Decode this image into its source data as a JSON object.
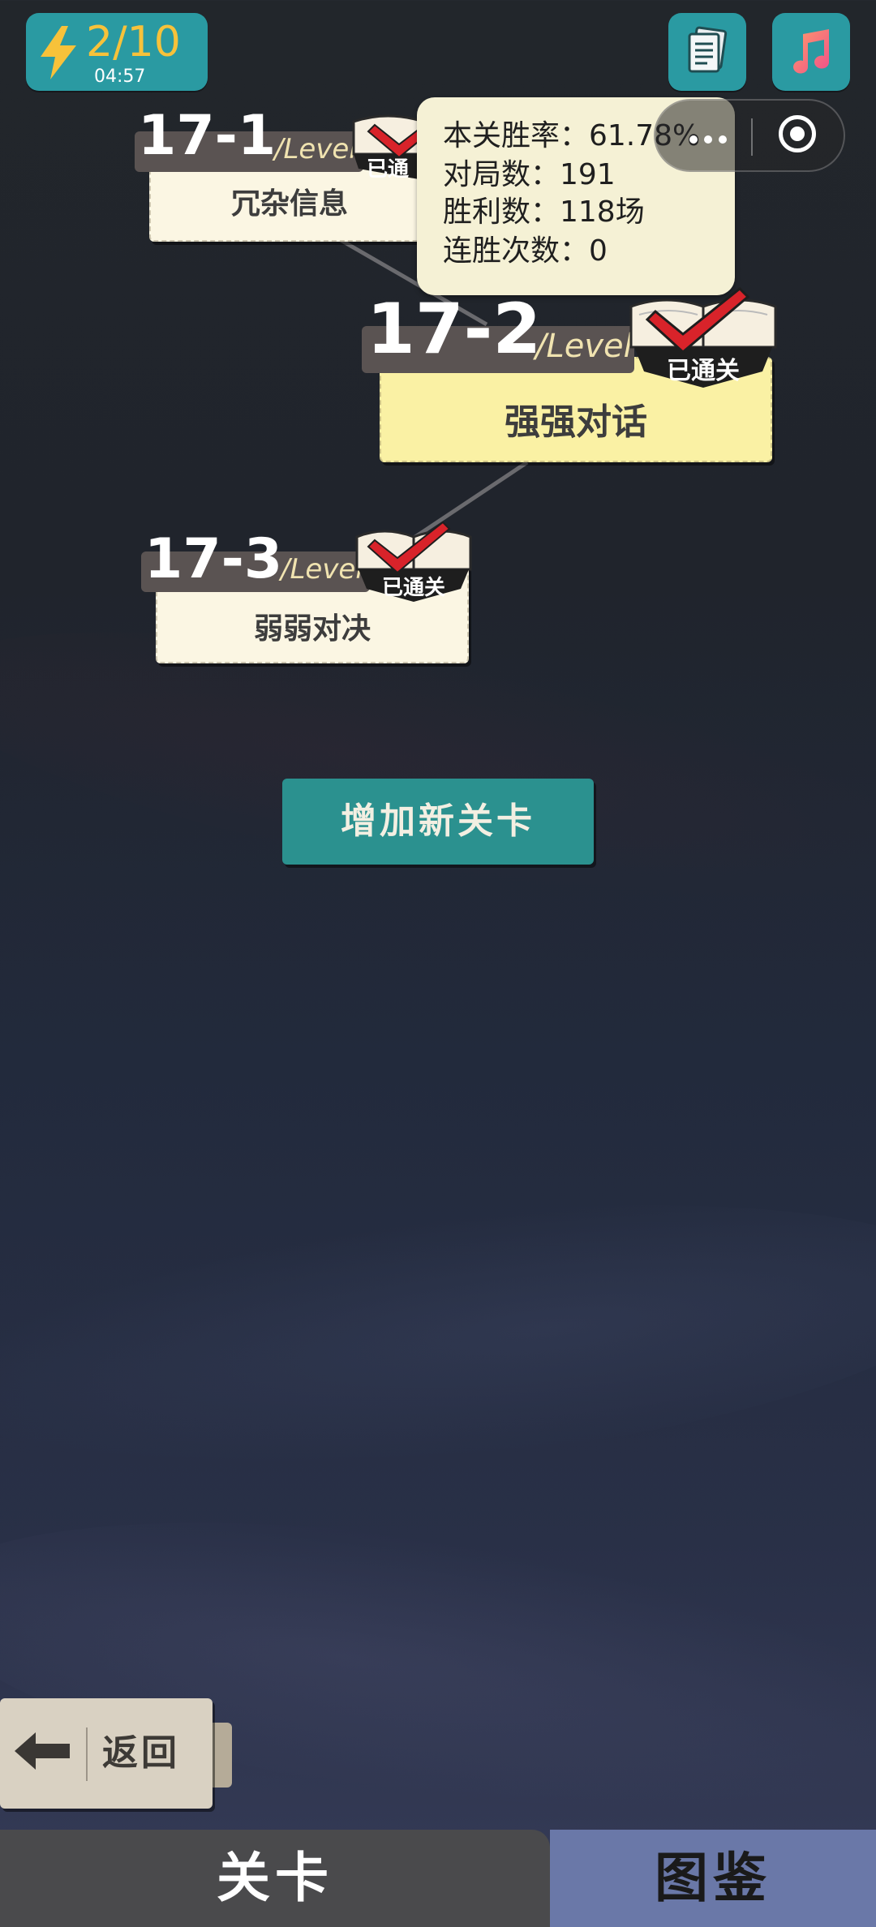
{
  "energy": {
    "count": "2/10",
    "timer": "04:57"
  },
  "top_icons": [
    "document-icon",
    "music-note-icon"
  ],
  "levels": [
    {
      "number": "17-1",
      "suffix": "/Level",
      "name": "冗杂信息",
      "cleared_label": "已通"
    },
    {
      "number": "17-2",
      "suffix": "/Level",
      "name": "强强对话",
      "cleared_label": "已通关"
    },
    {
      "number": "17-3",
      "suffix": "/Level",
      "name": "弱弱对决",
      "cleared_label": "已通关"
    }
  ],
  "stats": {
    "win_rate": "本关胜率：61.78%",
    "matches": "对局数：191",
    "wins": "胜利数：118场",
    "streak": "连胜次数：0"
  },
  "add_level_label": "增加新关卡",
  "back_label": "返回",
  "tabs": {
    "levels": "关卡",
    "atlas": "图鉴"
  },
  "colors": {
    "teal": "#2a9aa2",
    "card": "#fbf6e3",
    "card_selected": "#faf1a4",
    "tag": "#5a5352",
    "badge_red": "#d8232a",
    "tab_active": "#4a4a4c",
    "tab_inactive": "#6a78a8"
  }
}
